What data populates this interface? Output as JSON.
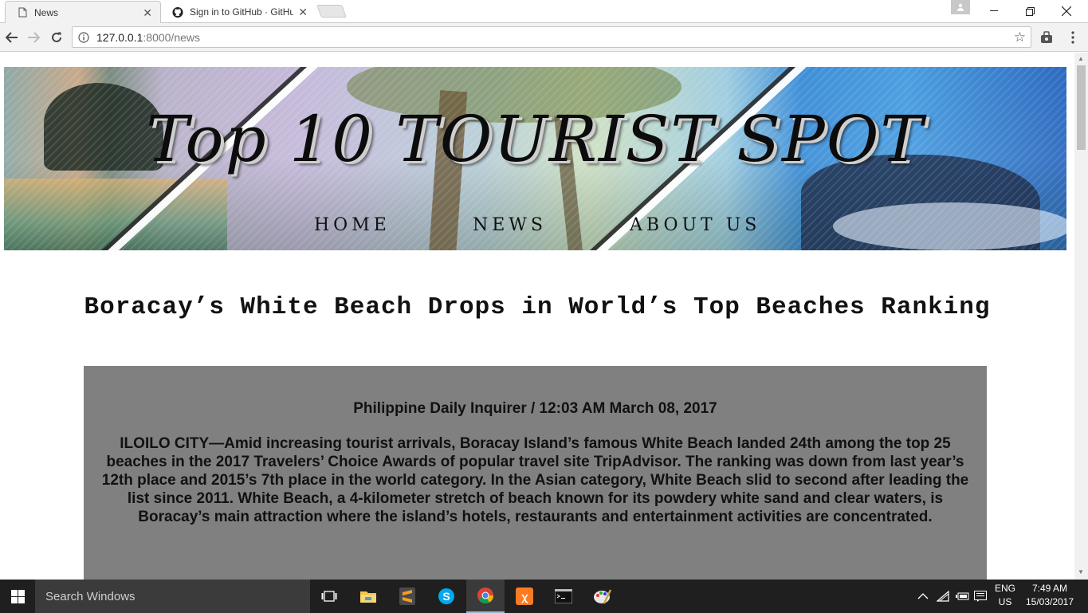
{
  "browser": {
    "tabs": [
      {
        "title": "News"
      },
      {
        "title": "Sign in to GitHub · GitHub"
      }
    ],
    "url_host": "127.0.0.1",
    "url_path": ":8000/news"
  },
  "site": {
    "title": "Top 10 TOURIST SPOT",
    "nav": [
      {
        "label": "HOME"
      },
      {
        "label": "NEWS"
      },
      {
        "label": "ABOUT US"
      }
    ]
  },
  "article": {
    "headline": "Boracay’s White Beach Drops in World’s Top Beaches Ranking",
    "source": "Philippine Daily Inquirer / 12:03 AM March 08, 2017",
    "body": "ILOILO CITY—Amid increasing tourist arrivals, Boracay Island’s famous White Beach landed 24th among the top 25 beaches in the 2017 Travelers’ Choice Awards of popular travel site TripAdvisor. The ranking was down from last year’s 12th place and 2015’s 7th place in the world category. In the Asian category, White Beach slid to second after leading the list since 2011. White Beach, a 4-kilometer stretch of beach known for its powdery white sand and clear waters, is Boracay’s main attraction where the island’s hotels, restaurants and entertainment activities are concentrated."
  },
  "taskbar": {
    "search_placeholder": "Search Windows",
    "lang_line1": "ENG",
    "lang_line2": "US",
    "time": "7:49 AM",
    "date": "15/03/2017",
    "apps": [
      "task-view",
      "file-explorer",
      "sublime-text",
      "skype",
      "chrome",
      "xampp",
      "command-prompt",
      "paint"
    ]
  },
  "colors": {
    "article_bg": "#808080",
    "taskbar_bg": "#1f1f1f",
    "chrome_toolbar": "#f2f2f2"
  }
}
